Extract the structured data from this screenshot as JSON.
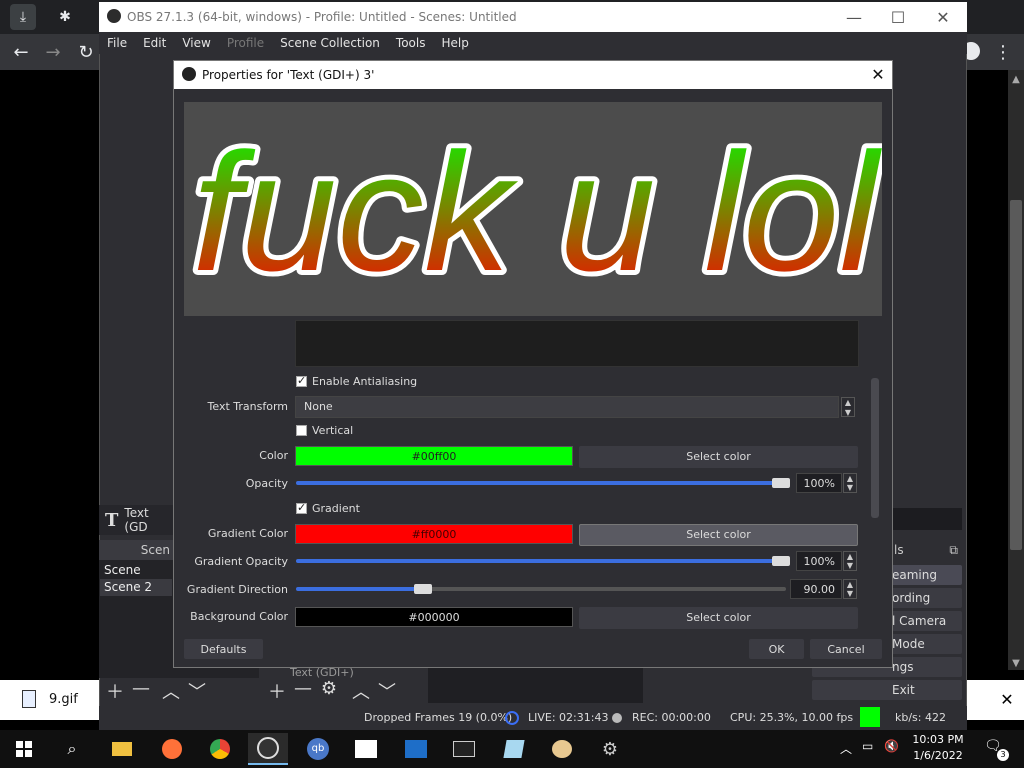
{
  "browser": {
    "back": "←",
    "forward": "→",
    "reload": "↻",
    "menu": "⋮"
  },
  "obs": {
    "title": "OBS 27.1.3 (64-bit, windows) - Profile: Untitled - Scenes: Untitled",
    "menu": [
      "File",
      "Edit",
      "View",
      "Profile",
      "Scene Collection",
      "Tools",
      "Help"
    ],
    "sources_header": "Text (GD",
    "scenes_title": "Scen",
    "scenes": [
      "Scene",
      "Scene 2"
    ],
    "source_item": "Text (GDI+)",
    "controls_title": "ls",
    "controls": [
      "eaming",
      "ording",
      "l Camera",
      "Mode",
      "ngs",
      "Exit"
    ],
    "status": {
      "dropped": "Dropped Frames 19 (0.0%)",
      "live": "LIVE: 02:31:43",
      "rec": "REC: 00:00:00",
      "cpu": "CPU: 25.3%, 10.00 fps",
      "kbps": "kb/s: 422"
    }
  },
  "dialog": {
    "title": "Properties for 'Text (GDI+) 3'",
    "preview_text": "fuck u lol",
    "enable_antialiasing": "Enable Antialiasing",
    "text_transform_label": "Text Transform",
    "text_transform_value": "None",
    "vertical_label": "Vertical",
    "color_label": "Color",
    "color_value": "#00ff00",
    "select_color": "Select color",
    "opacity_label": "Opacity",
    "opacity_value": "100%",
    "gradient_label": "Gradient",
    "gradient_color_label": "Gradient Color",
    "gradient_color_value": "#ff0000",
    "gradient_opacity_label": "Gradient Opacity",
    "gradient_opacity_value": "100%",
    "gradient_direction_label": "Gradient Direction",
    "gradient_direction_value": "90.00",
    "background_color_label": "Background Color",
    "background_color_value": "#000000",
    "defaults": "Defaults",
    "ok": "OK",
    "cancel": "Cancel",
    "opacity_fraction": 1.0,
    "gradient_opacity_fraction": 1.0,
    "gradient_direction_fraction": 0.25
  },
  "download": {
    "filename": "9.gif"
  },
  "taskbar": {
    "time": "10:03 PM",
    "date": "1/6/2022",
    "notifications": "3"
  },
  "colors": {
    "text_color": "#00ff00",
    "gradient_color": "#ff0000",
    "background_color": "#000000",
    "accent": "#3b6ee0"
  }
}
